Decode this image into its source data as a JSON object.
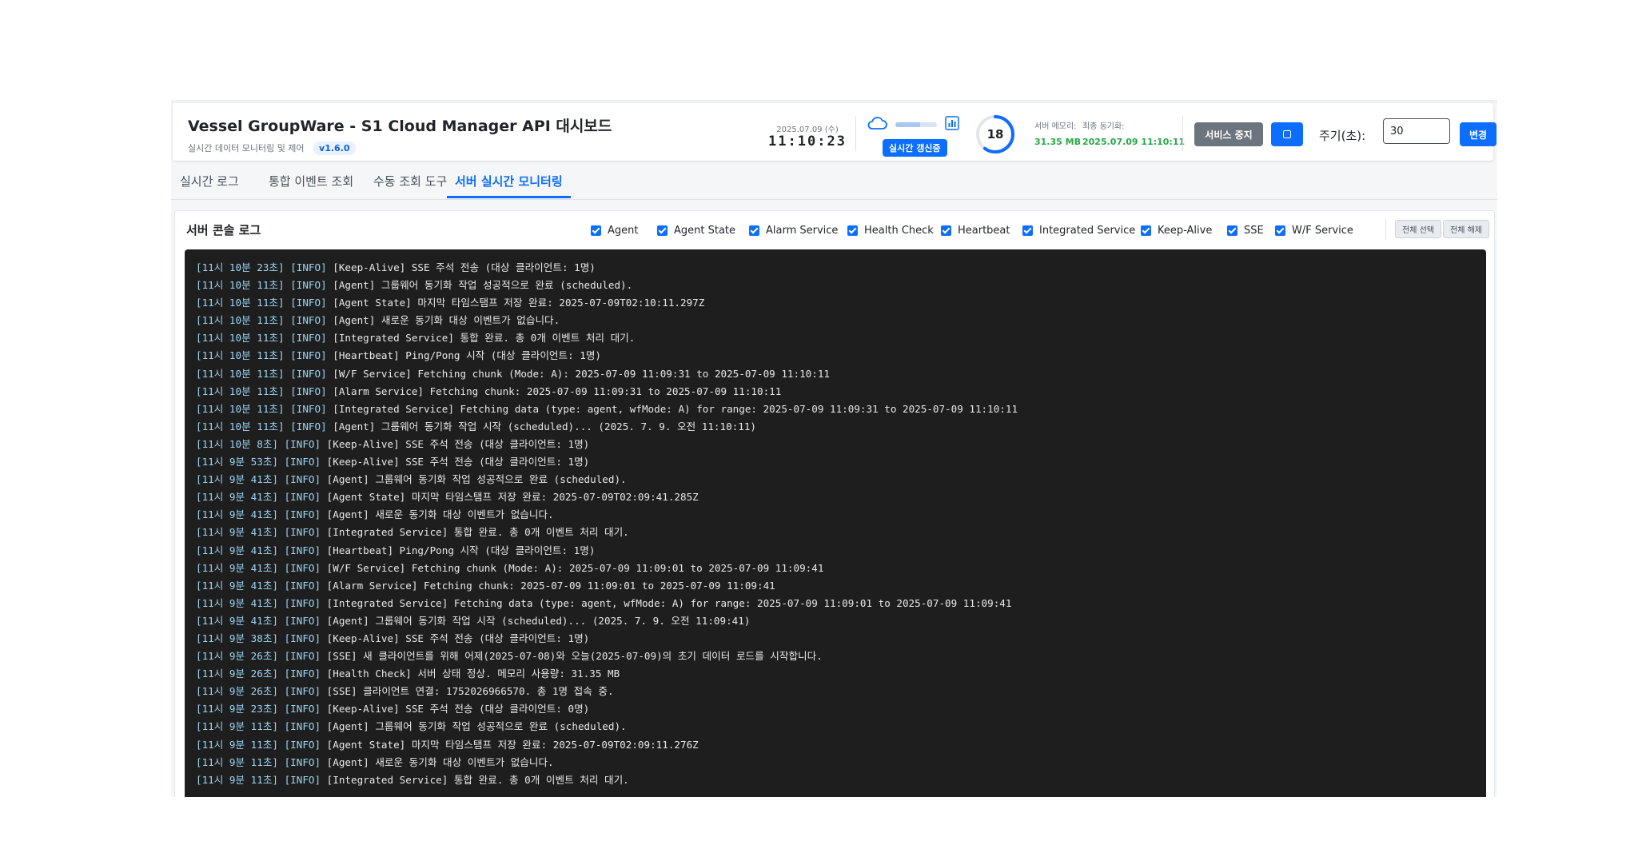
{
  "header": {
    "title": "Vessel GroupWare - S1 Cloud Manager API 대시보드",
    "subtitle": "실시간 데이터 모니터링 및 제어",
    "version": "v1.6.0",
    "date": "2025.07.09 (수)",
    "time": "11:10:23",
    "live_badge": "실시간 갱신중",
    "countdown": "18",
    "countdown_fraction": 0.6,
    "server_memory_label": "서버 메모리:",
    "server_memory_value": "31.35 MB",
    "last_sync_label": "최종 동기화:",
    "last_sync_value": "2025.07.09 11:10:11",
    "stop_button": "서비스 중지",
    "period_label": "주기(초):",
    "period_value": "30",
    "change_button": "변경",
    "colors": {
      "accent": "#0d6efd",
      "success": "#28a745",
      "secondary": "#6c757d"
    }
  },
  "tabs": [
    {
      "label": "실시간 로그"
    },
    {
      "label": "통합 이벤트 조회"
    },
    {
      "label": "수동 조회 도구"
    },
    {
      "label": "서버 실시간 모니터링"
    }
  ],
  "active_tab": 3,
  "panel": {
    "title": "서버 콘솔 로그",
    "filters": [
      {
        "label": "Agent",
        "checked": true
      },
      {
        "label": "Agent State",
        "checked": true
      },
      {
        "label": "Alarm Service",
        "checked": true
      },
      {
        "label": "Health Check",
        "checked": true
      },
      {
        "label": "Heartbeat",
        "checked": true
      },
      {
        "label": "Integrated Service",
        "checked": true
      },
      {
        "label": "Keep-Alive",
        "checked": true
      },
      {
        "label": "SSE",
        "checked": true
      },
      {
        "label": "W/F Service",
        "checked": true
      }
    ],
    "select_all": "전체 선택",
    "deselect_all": "전체 해제"
  },
  "logs": [
    {
      "ts": "[11시 10분 23초]",
      "level": "[INFO]",
      "msg": " [Keep-Alive] SSE 주석 전송 (대상 클라이언트: 1명)"
    },
    {
      "ts": "[11시 10분 11초]",
      "level": "[INFO]",
      "msg": " [Agent] 그룹웨어 동기화 작업 성공적으로 완료 (scheduled)."
    },
    {
      "ts": "[11시 10분 11초]",
      "level": "[INFO]",
      "msg": " [Agent State] 마지막 타임스탬프 저장 완료: 2025-07-09T02:10:11.297Z"
    },
    {
      "ts": "[11시 10분 11초]",
      "level": "[INFO]",
      "msg": " [Agent] 새로운 동기화 대상 이벤트가 없습니다."
    },
    {
      "ts": "[11시 10분 11초]",
      "level": "[INFO]",
      "msg": " [Integrated Service] 통합 완료. 총 0개 이벤트 처리 대기."
    },
    {
      "ts": "[11시 10분 11초]",
      "level": "[INFO]",
      "msg": " [Heartbeat] Ping/Pong 시작 (대상 클라이언트: 1명)"
    },
    {
      "ts": "[11시 10분 11초]",
      "level": "[INFO]",
      "msg": " [W/F Service] Fetching chunk (Mode: A): 2025-07-09 11:09:31 to 2025-07-09 11:10:11"
    },
    {
      "ts": "[11시 10분 11초]",
      "level": "[INFO]",
      "msg": " [Alarm Service] Fetching chunk: 2025-07-09 11:09:31 to 2025-07-09 11:10:11"
    },
    {
      "ts": "[11시 10분 11초]",
      "level": "[INFO]",
      "msg": " [Integrated Service] Fetching data (type: agent, wfMode: A) for range: 2025-07-09 11:09:31 to 2025-07-09 11:10:11"
    },
    {
      "ts": "[11시 10분 11초]",
      "level": "[INFO]",
      "msg": " [Agent] 그룹웨어 동기화 작업 시작 (scheduled)... (2025. 7. 9. 오전 11:10:11)"
    },
    {
      "ts": "[11시 10분 8초]",
      "level": "[INFO]",
      "msg": " [Keep-Alive] SSE 주석 전송 (대상 클라이언트: 1명)"
    },
    {
      "ts": "[11시 9분 53초]",
      "level": "[INFO]",
      "msg": " [Keep-Alive] SSE 주석 전송 (대상 클라이언트: 1명)"
    },
    {
      "ts": "[11시 9분 41초]",
      "level": "[INFO]",
      "msg": " [Agent] 그룹웨어 동기화 작업 성공적으로 완료 (scheduled)."
    },
    {
      "ts": "[11시 9분 41초]",
      "level": "[INFO]",
      "msg": " [Agent State] 마지막 타임스탬프 저장 완료: 2025-07-09T02:09:41.285Z"
    },
    {
      "ts": "[11시 9분 41초]",
      "level": "[INFO]",
      "msg": " [Agent] 새로운 동기화 대상 이벤트가 없습니다."
    },
    {
      "ts": "[11시 9분 41초]",
      "level": "[INFO]",
      "msg": " [Integrated Service] 통합 완료. 총 0개 이벤트 처리 대기."
    },
    {
      "ts": "[11시 9분 41초]",
      "level": "[INFO]",
      "msg": " [Heartbeat] Ping/Pong 시작 (대상 클라이언트: 1명)"
    },
    {
      "ts": "[11시 9분 41초]",
      "level": "[INFO]",
      "msg": " [W/F Service] Fetching chunk (Mode: A): 2025-07-09 11:09:01 to 2025-07-09 11:09:41"
    },
    {
      "ts": "[11시 9분 41초]",
      "level": "[INFO]",
      "msg": " [Alarm Service] Fetching chunk: 2025-07-09 11:09:01 to 2025-07-09 11:09:41"
    },
    {
      "ts": "[11시 9분 41초]",
      "level": "[INFO]",
      "msg": " [Integrated Service] Fetching data (type: agent, wfMode: A) for range: 2025-07-09 11:09:01 to 2025-07-09 11:09:41"
    },
    {
      "ts": "[11시 9분 41초]",
      "level": "[INFO]",
      "msg": " [Agent] 그룹웨어 동기화 작업 시작 (scheduled)... (2025. 7. 9. 오전 11:09:41)"
    },
    {
      "ts": "[11시 9분 38초]",
      "level": "[INFO]",
      "msg": " [Keep-Alive] SSE 주석 전송 (대상 클라이언트: 1명)"
    },
    {
      "ts": "[11시 9분 26초]",
      "level": "[INFO]",
      "msg": " [SSE] 새 클라이언트를 위해 어제(2025-07-08)와 오늘(2025-07-09)의 초기 데이터 로드를 시작합니다."
    },
    {
      "ts": "[11시 9분 26초]",
      "level": "[INFO]",
      "msg": " [Health Check] 서버 상태 정상. 메모리 사용량: 31.35 MB"
    },
    {
      "ts": "[11시 9분 26초]",
      "level": "[INFO]",
      "msg": " [SSE] 클라이언트 연결: 1752026966570. 총 1명 접속 중."
    },
    {
      "ts": "[11시 9분 23초]",
      "level": "[INFO]",
      "msg": " [Keep-Alive] SSE 주석 전송 (대상 클라이언트: 0명)"
    },
    {
      "ts": "[11시 9분 11초]",
      "level": "[INFO]",
      "msg": " [Agent] 그룹웨어 동기화 작업 성공적으로 완료 (scheduled)."
    },
    {
      "ts": "[11시 9분 11초]",
      "level": "[INFO]",
      "msg": " [Agent State] 마지막 타임스탬프 저장 완료: 2025-07-09T02:09:11.276Z"
    },
    {
      "ts": "[11시 9분 11초]",
      "level": "[INFO]",
      "msg": " [Agent] 새로운 동기화 대상 이벤트가 없습니다."
    },
    {
      "ts": "[11시 9분 11초]",
      "level": "[INFO]",
      "msg": " [Integrated Service] 통합 완료. 총 0개 이벤트 처리 대기."
    }
  ]
}
